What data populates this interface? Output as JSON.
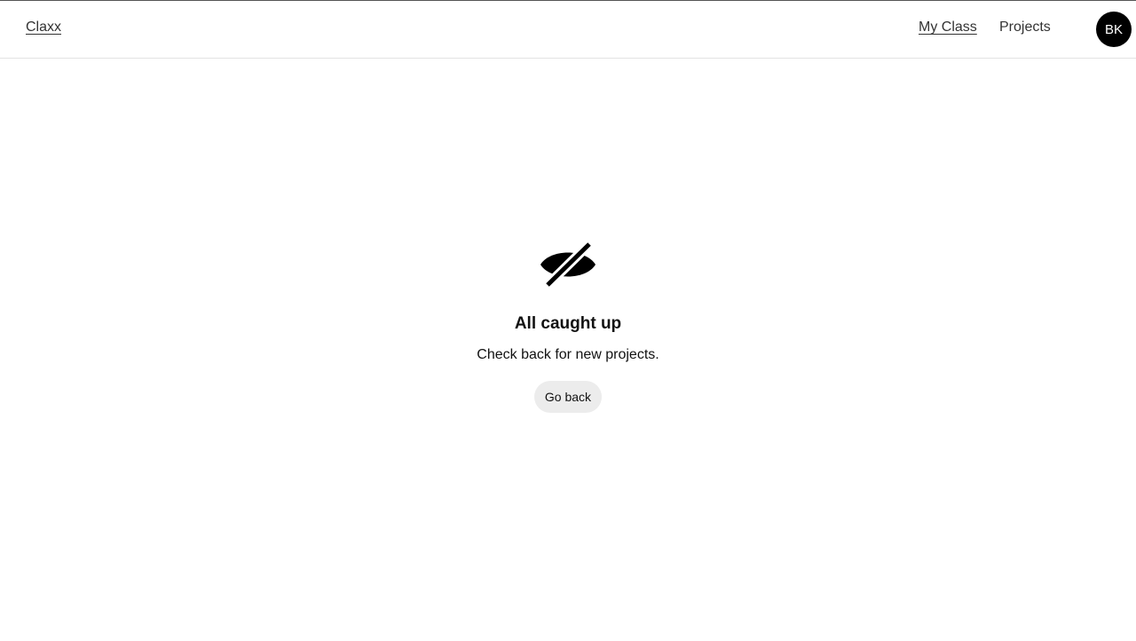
{
  "header": {
    "brand": "Claxx",
    "nav": {
      "my_class": "My Class",
      "projects": "Projects"
    },
    "avatar_initials": "BK"
  },
  "empty_state": {
    "icon": "eye-slash-icon",
    "title": "All caught up",
    "description": "Check back for new projects.",
    "button_label": "Go back"
  },
  "colors": {
    "avatar_bg": "#000000",
    "button_bg": "#ececec",
    "divider": "#e3e3e3"
  }
}
